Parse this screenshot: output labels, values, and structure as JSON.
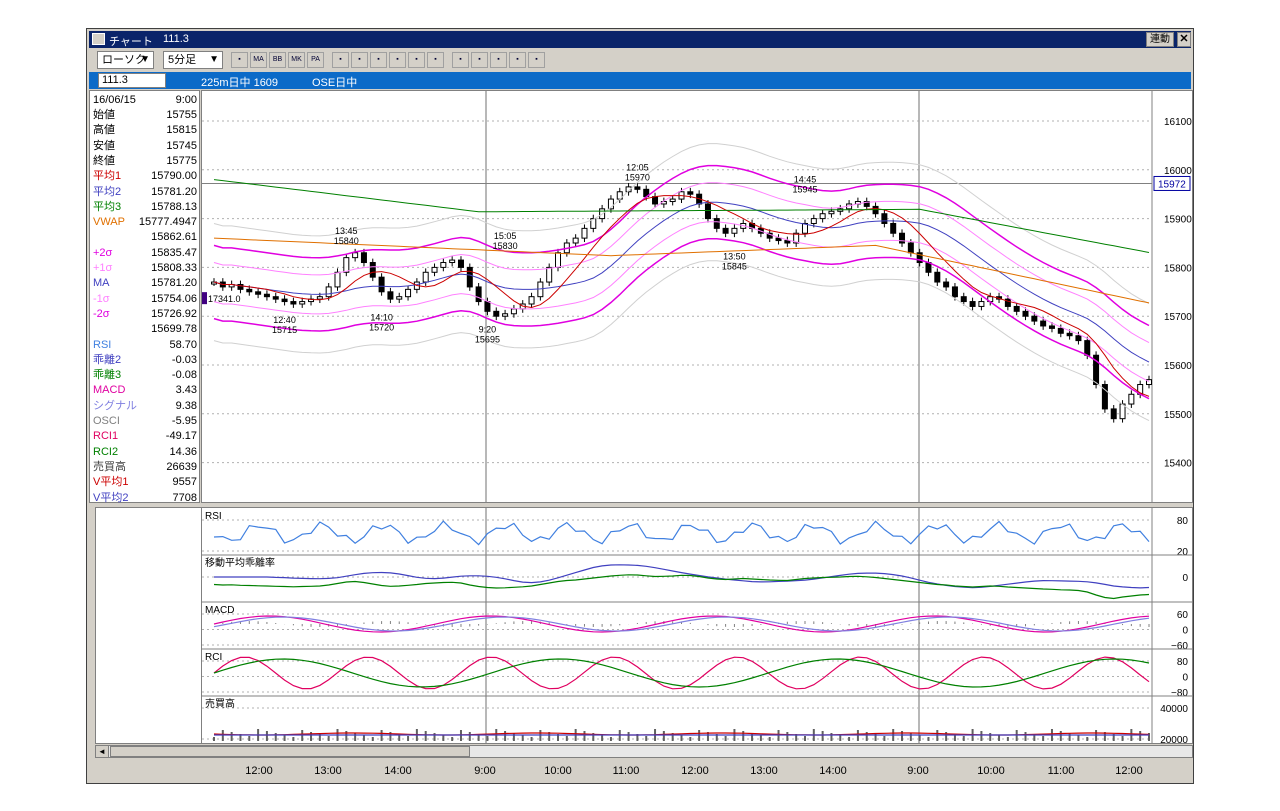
{
  "window": {
    "title": "チャート",
    "code": "111.3",
    "linked_label": "連動",
    "close_icon": "close-icon"
  },
  "toolbar": {
    "chart_type": "ローソク",
    "interval": "5分足",
    "buttons": [
      {
        "name": "chart-style-icon",
        "label": ""
      },
      {
        "name": "ma-button",
        "label": "MA"
      },
      {
        "name": "bb-button",
        "label": "BB"
      },
      {
        "name": "mk-button",
        "label": "MK"
      },
      {
        "name": "pa-button",
        "label": "PA"
      },
      {
        "name": "trend-icon",
        "label": ""
      },
      {
        "name": "fibonacci-icon",
        "label": ""
      },
      {
        "name": "gann-icon",
        "label": ""
      },
      {
        "name": "zoom-icon",
        "label": ""
      },
      {
        "name": "calendar-icon",
        "label": ""
      },
      {
        "name": "settings-icon",
        "label": ""
      },
      {
        "name": "pen-icon",
        "label": ""
      },
      {
        "name": "cursor-icon",
        "label": ""
      },
      {
        "name": "eraser-icon",
        "label": ""
      },
      {
        "name": "search-icon",
        "label": ""
      },
      {
        "name": "ruler-icon",
        "label": ""
      }
    ]
  },
  "infobar": {
    "code_value": "111.3",
    "symbol": "225m日中 1609",
    "market": "OSE日中"
  },
  "datapanel": {
    "date": "16/06/15",
    "time": "9:00",
    "rows": [
      {
        "label": "始値",
        "value": "15755",
        "color": "#000000"
      },
      {
        "label": "高値",
        "value": "15815",
        "color": "#000000"
      },
      {
        "label": "安値",
        "value": "15745",
        "color": "#000000"
      },
      {
        "label": "終値",
        "value": "15775",
        "color": "#000000"
      },
      {
        "label": "平均1",
        "value": "15790.00",
        "color": "#cc0000"
      },
      {
        "label": "平均2",
        "value": "15781.20",
        "color": "#4040c0"
      },
      {
        "label": "平均3",
        "value": "15788.13",
        "color": "#008000"
      },
      {
        "label": "VWAP",
        "value": "15777.4947",
        "color": "#e07000"
      },
      {
        "label": "",
        "value": "15862.61",
        "color": "#000000"
      },
      {
        "label": "+2σ",
        "value": "15835.47",
        "color": "#e000e0"
      },
      {
        "label": "+1σ",
        "value": "15808.33",
        "color": "#ff80ff"
      },
      {
        "label": "MA",
        "value": "15781.20",
        "color": "#4040c0"
      },
      {
        "label": "-1σ",
        "value": "15754.06",
        "color": "#ff80ff"
      },
      {
        "label": "-2σ",
        "value": "15726.92",
        "color": "#e000e0"
      },
      {
        "label": "",
        "value": "15699.78",
        "color": "#000000"
      },
      {
        "label": "RSI",
        "value": "58.70",
        "color": "#4080e0"
      },
      {
        "label": "乖離2",
        "value": "-0.03",
        "color": "#4040c0"
      },
      {
        "label": "乖離3",
        "value": "-0.08",
        "color": "#008000"
      },
      {
        "label": "MACD",
        "value": "3.43",
        "color": "#e000a0"
      },
      {
        "label": "シグナル",
        "value": "9.38",
        "color": "#8080e0"
      },
      {
        "label": "OSCI",
        "value": "-5.95",
        "color": "#808080"
      },
      {
        "label": "RCI1",
        "value": "-49.17",
        "color": "#e00060"
      },
      {
        "label": "RCI2",
        "value": "14.36",
        "color": "#008000"
      },
      {
        "label": "売買高",
        "value": "26639",
        "color": "#404040"
      },
      {
        "label": "V平均1",
        "value": "9557",
        "color": "#cc0000"
      },
      {
        "label": "V平均2",
        "value": "7708",
        "color": "#4040c0"
      }
    ]
  },
  "main_chart": {
    "price_ticks": [
      "16100",
      "16000",
      "15900",
      "15800",
      "15700",
      "15600",
      "15500",
      "15400"
    ],
    "current_price": "15972",
    "annotations": [
      {
        "time": "13:45",
        "price": "15840"
      },
      {
        "time": "15:05",
        "price": "15830"
      },
      {
        "time": "12:05",
        "price": "15970"
      },
      {
        "time": "14:45",
        "price": "15945"
      },
      {
        "time": "12:40",
        "price": "15715"
      },
      {
        "time": "14:10",
        "price": "15720"
      },
      {
        "time": "9:20",
        "price": "15695"
      },
      {
        "time": "13:50",
        "price": "15845"
      }
    ],
    "left_label": "17341.0"
  },
  "sub_charts": [
    {
      "label": "RSI",
      "ticks": [
        "80",
        "20"
      ]
    },
    {
      "label": "移動平均乖離率",
      "ticks": [
        "0"
      ]
    },
    {
      "label": "MACD",
      "ticks": [
        "60",
        "0",
        "−60"
      ]
    },
    {
      "label": "RCI",
      "ticks": [
        "80",
        "0",
        "−80"
      ]
    },
    {
      "label": "売買高",
      "ticks": [
        "40000",
        "20000"
      ]
    }
  ],
  "time_axis": [
    "12:00",
    "13:00",
    "14:00",
    "9:00",
    "10:00",
    "11:00",
    "12:00",
    "13:00",
    "14:00",
    "9:00",
    "10:00",
    "11:00",
    "12:00"
  ]
}
